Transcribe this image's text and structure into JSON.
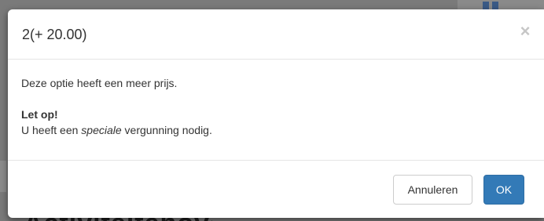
{
  "modal": {
    "title": "2(+ 20.00)",
    "close_label": "×",
    "body": {
      "intro": "Deze optie heeft een meer prijs.",
      "notice_heading": "Let op!",
      "notice_before": "U heeft een ",
      "notice_emphasis": "speciale",
      "notice_after": " vergunning nodig."
    },
    "footer": {
      "cancel_label": "Annuleren",
      "ok_label": "OK"
    }
  },
  "background": {
    "heading_fragment": "Activiteitenoverzicht"
  },
  "colors": {
    "primary": "#337ab7",
    "primary_border": "#2e6da4",
    "text": "#333333",
    "divider": "#e5e5e5"
  }
}
